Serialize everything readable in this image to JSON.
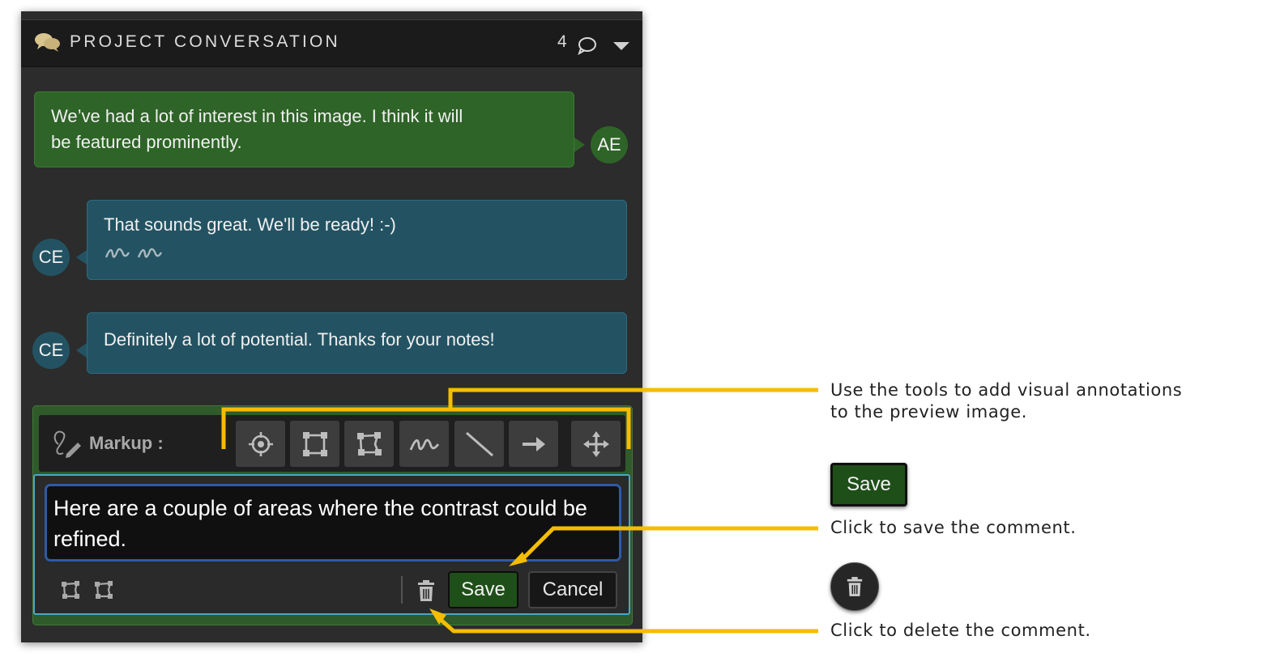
{
  "header": {
    "title": "PROJECT CONVERSATION",
    "comment_count": "4"
  },
  "messages": [
    {
      "author_initials": "AE",
      "text_line1": "We’ve had a lot of interest in this image. I think it will",
      "text_line2": "be featured prominently.",
      "side": "right",
      "color": "#2e6427"
    },
    {
      "author_initials": "CE",
      "text": "That sounds great. We'll be ready! :-)",
      "has_markup": true,
      "side": "left",
      "color": "#235363"
    },
    {
      "author_initials": "CE",
      "text": "Definitely a lot of potential. Thanks for your notes!",
      "side": "left",
      "color": "#235363"
    }
  ],
  "composer": {
    "markup_label": "Markup :",
    "tools": [
      "crosshair-icon",
      "rectangle-icon",
      "polygon-icon",
      "freehand-icon",
      "line-icon",
      "arrow-icon",
      "move-icon"
    ],
    "text": "Here are a couple of areas where the contrast could be refined.",
    "save_label": "Save",
    "cancel_label": "Cancel"
  },
  "annotations": {
    "tools_note_line1": "Use the tools to add visual annotations",
    "tools_note_line2": "to the preview image.",
    "save_example_label": "Save",
    "save_note": "Click to save the comment.",
    "delete_note": "Click to delete the comment."
  },
  "colors": {
    "callout": "#f5bd00",
    "green_bubble": "#2e6427",
    "blue_bubble": "#235363",
    "save_button": "#1f4f18"
  }
}
